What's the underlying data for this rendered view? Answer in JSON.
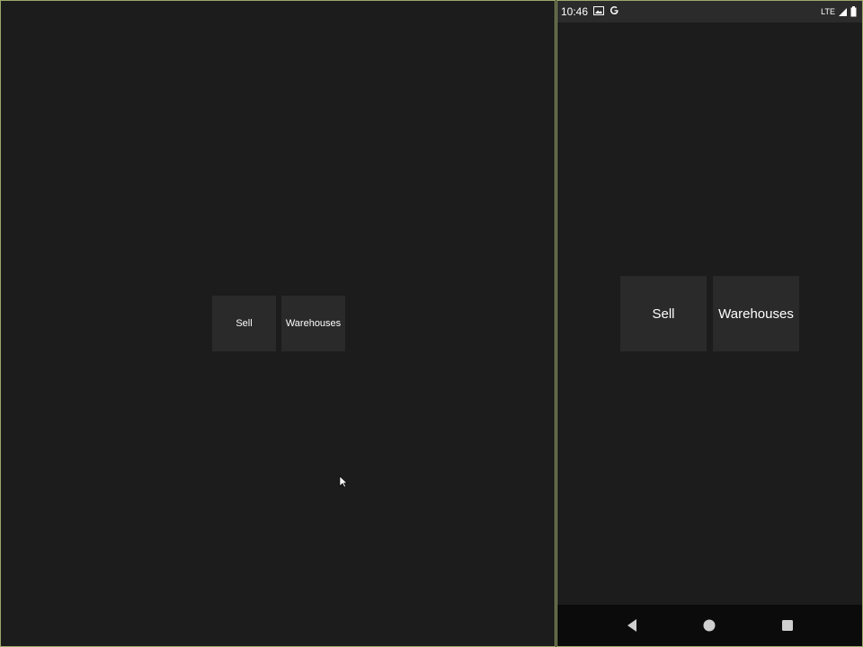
{
  "desktop": {
    "buttons": {
      "sell_label": "Sell",
      "warehouses_label": "Warehouses"
    }
  },
  "phone": {
    "statusbar": {
      "time": "10:46",
      "network": "LTE"
    },
    "buttons": {
      "sell_label": "Sell",
      "warehouses_label": "Warehouses"
    }
  },
  "colors": {
    "background": "#1c1c1c",
    "button_bg": "#2a2a2a",
    "frame_border": "#9aa86a"
  }
}
